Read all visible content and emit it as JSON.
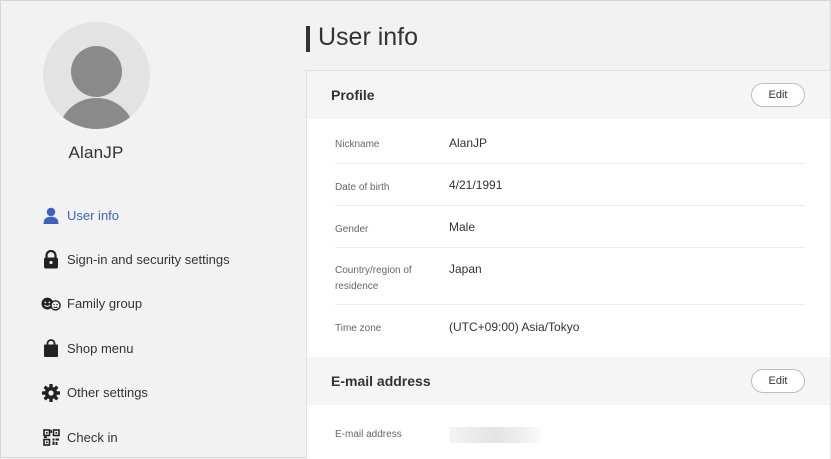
{
  "sidebar": {
    "username": "AlanJP",
    "items": [
      {
        "label": "User info",
        "icon": "person-icon",
        "active": true
      },
      {
        "label": "Sign-in and security settings",
        "icon": "lock-icon",
        "active": false
      },
      {
        "label": "Family group",
        "icon": "family-icon",
        "active": false
      },
      {
        "label": "Shop menu",
        "icon": "shopping-bag-icon",
        "active": false
      },
      {
        "label": "Other settings",
        "icon": "gear-icon",
        "active": false
      },
      {
        "label": "Check in",
        "icon": "qr-code-icon",
        "active": false
      }
    ]
  },
  "main": {
    "title": "User info",
    "profile": {
      "title": "Profile",
      "edit_label": "Edit",
      "rows": [
        {
          "label": "Nickname",
          "value": "AlanJP"
        },
        {
          "label": "Date of birth",
          "value": "4/21/1991"
        },
        {
          "label": "Gender",
          "value": "Male"
        },
        {
          "label": "Country/region of residence",
          "value": "Japan"
        },
        {
          "label": "Time zone",
          "value": "(UTC+09:00) Asia/Tokyo"
        }
      ]
    },
    "email": {
      "title": "E-mail address",
      "edit_label": "Edit",
      "field_label": "E-mail address"
    }
  },
  "colors": {
    "accent": "#3a63c8",
    "background": "#f2f2f2",
    "card": "#ffffff",
    "text": "#333333"
  }
}
